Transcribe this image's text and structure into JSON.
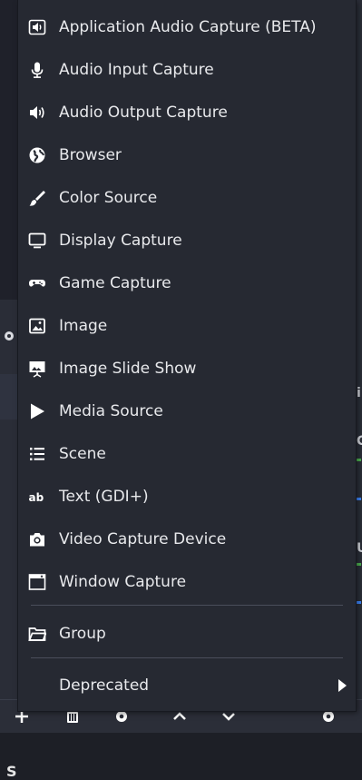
{
  "menu": {
    "items": [
      {
        "label": "Application Audio Capture (BETA)",
        "icon": "speaker-box-icon"
      },
      {
        "label": "Audio Input Capture",
        "icon": "microphone-icon"
      },
      {
        "label": "Audio Output Capture",
        "icon": "speaker-volume-icon"
      },
      {
        "label": "Browser",
        "icon": "globe-icon"
      },
      {
        "label": "Color Source",
        "icon": "paint-brush-icon"
      },
      {
        "label": "Display Capture",
        "icon": "monitor-icon"
      },
      {
        "label": "Game Capture",
        "icon": "gamepad-icon"
      },
      {
        "label": "Image",
        "icon": "image-icon"
      },
      {
        "label": "Image Slide Show",
        "icon": "slideshow-icon"
      },
      {
        "label": "Media Source",
        "icon": "play-icon"
      },
      {
        "label": "Scene",
        "icon": "list-icon"
      },
      {
        "label": "Text (GDI+)",
        "icon": "text-ab-icon"
      },
      {
        "label": "Video Capture Device",
        "icon": "camera-icon"
      },
      {
        "label": "Window Capture",
        "icon": "window-icon"
      }
    ],
    "group_label": "Group",
    "group_icon": "folder-icon",
    "deprecated_label": "Deprecated",
    "deprecated_arrow_icon": "chevron-right-icon"
  },
  "background": {
    "left_letter": "S",
    "right_letters": [
      "i",
      "C",
      "U"
    ],
    "bottom_buttons": [
      "plus-icon",
      "trash-icon",
      "gear-icon",
      "chevron-up-icon",
      "chevron-down-icon",
      "gear-icon"
    ]
  },
  "colors": {
    "menu_bg": "#262932",
    "text": "#e8e9ec",
    "separator": "#4a4e5b",
    "accent_green": "#4caf50",
    "accent_blue": "#3b82f6"
  }
}
